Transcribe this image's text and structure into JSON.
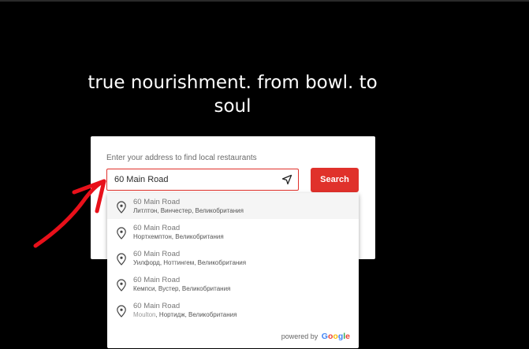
{
  "hero": {
    "line1": "true nourishment. from bowl. to",
    "line2": "soul"
  },
  "search": {
    "prompt": "Enter your address to find local restaurants",
    "value": "60 Main Road",
    "button_label": "Search",
    "locate_icon": "navigation-arrow-icon"
  },
  "suggestions": [
    {
      "main": "60 Main Road",
      "prefix": "",
      "sub": "Литлтон, Винчестер, Великобритания"
    },
    {
      "main": "60 Main Road",
      "prefix": "",
      "sub": "Нортхемптон, Великобритания"
    },
    {
      "main": "60 Main Road",
      "prefix": "",
      "sub": "Уилфорд, Ноттингем, Великобритания"
    },
    {
      "main": "60 Main Road",
      "prefix": "",
      "sub": "Кемпси, Вустер, Великобритания"
    },
    {
      "main": "60 Main Road",
      "prefix": "Moulton",
      "sub": ", Нортидж, Великобритания"
    }
  ],
  "attribution": {
    "powered_by": "powered by",
    "brand": "Google"
  },
  "colors": {
    "accent": "#e0312b",
    "background": "#000000",
    "annotation_arrow": "#e8101a"
  }
}
